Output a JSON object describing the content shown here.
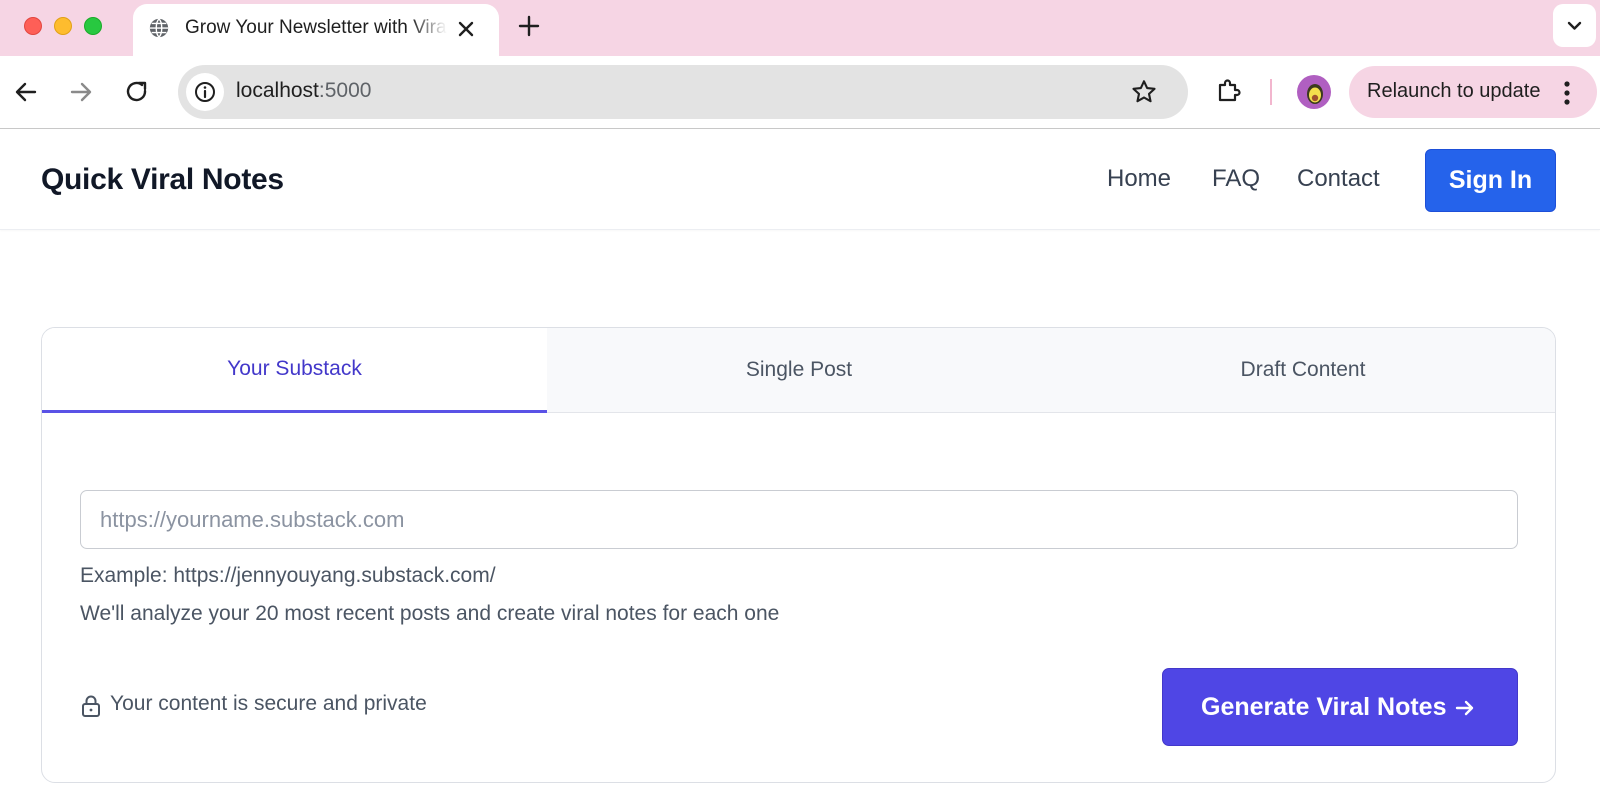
{
  "browser": {
    "tab": {
      "title": "Grow Your Newsletter with Viral Notes",
      "favicon": "globe-icon"
    },
    "address_bar": {
      "host": "localhost",
      "port": ":5000"
    },
    "relaunch_label": "Relaunch to update",
    "colors": {
      "frame": "#f6d5e4",
      "omnibox": "#e3e3e3"
    }
  },
  "site": {
    "brand": "Quick Viral Notes",
    "nav": {
      "home": "Home",
      "faq": "FAQ",
      "contact": "Contact",
      "sign_in": "Sign In"
    },
    "colors": {
      "primary_blue": "#2563eb",
      "accent_indigo": "#4f46e5"
    }
  },
  "main": {
    "tabs": [
      {
        "label": "Your Substack",
        "active": true
      },
      {
        "label": "Single Post",
        "active": false
      },
      {
        "label": "Draft Content",
        "active": false
      }
    ],
    "input": {
      "placeholder": "https://yourname.substack.com",
      "value": ""
    },
    "hint_example": "Example: https://jennyouyang.substack.com/",
    "hint_description": "We'll analyze your 20 most recent posts and create viral notes for each one",
    "security_note": "Your content is secure and private",
    "generate_button": "Generate Viral Notes"
  }
}
